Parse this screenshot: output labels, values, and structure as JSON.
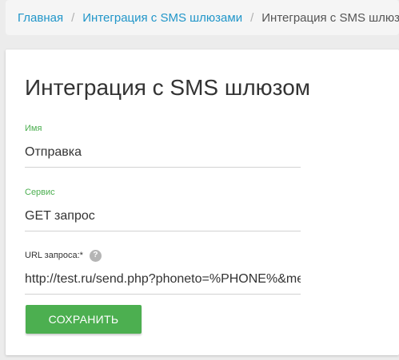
{
  "breadcrumb": {
    "items": [
      "Главная",
      "Интеграция с SMS шлюзами"
    ],
    "current": "Интеграция с SMS шлюзом",
    "separator": "/"
  },
  "page": {
    "title": "Интеграция с SMS шлюзом"
  },
  "form": {
    "name": {
      "label": "Имя",
      "value": "Отправка"
    },
    "service": {
      "label": "Сервис",
      "value": "GET запрос"
    },
    "url": {
      "label": "URL запроса:*",
      "help_icon": "?",
      "value": "http://test.ru/send.php?phoneto=%PHONE%&message=%MESSAGE%"
    },
    "save_label": "СОХРАНИТЬ"
  },
  "colors": {
    "link": "#2196c9",
    "accent": "#4caf50",
    "text": "#333333"
  }
}
